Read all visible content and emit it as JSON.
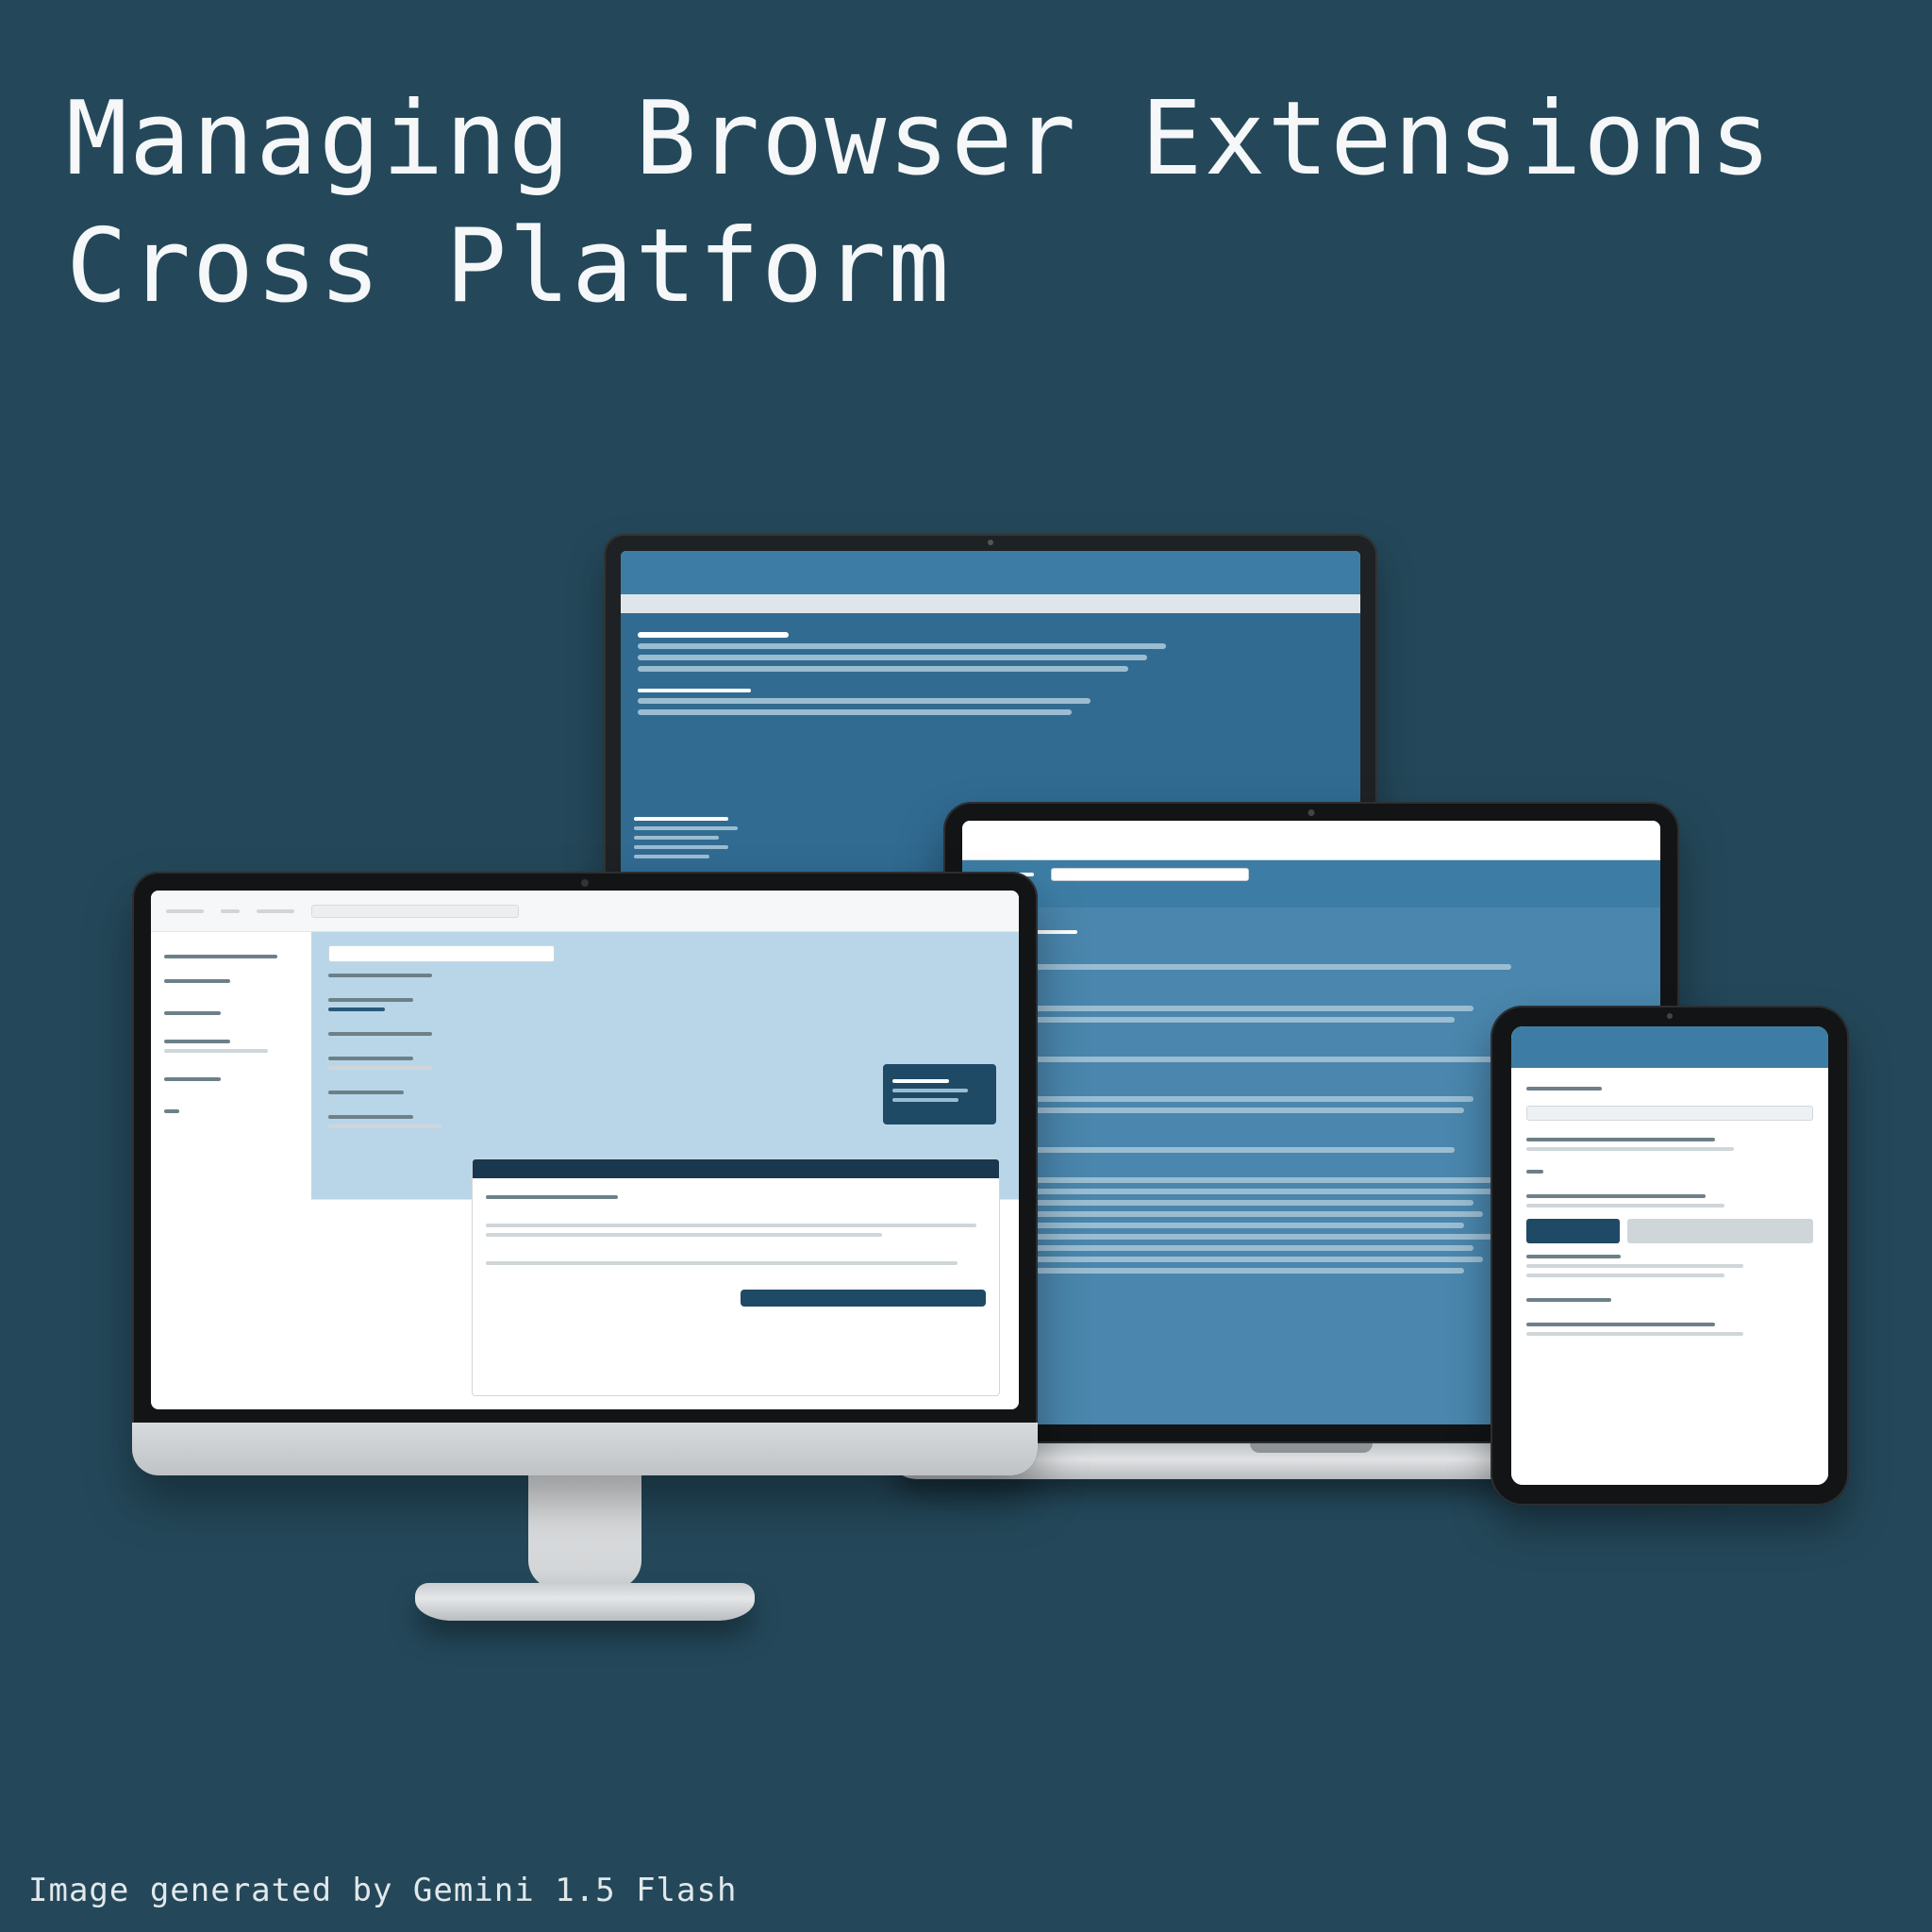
{
  "heading_line1": "Managing Browser Extensions",
  "heading_line2": "Cross Platform",
  "footer_caption": "Image generated by Gemini 1.5 Flash",
  "devices": {
    "imac": {
      "label": "desktop-imac"
    },
    "rear": {
      "label": "desktop-rear"
    },
    "laptop": {
      "label": "laptop"
    },
    "tablet": {
      "label": "tablet"
    }
  },
  "colors": {
    "background": "#24485a",
    "accent_blue": "#3d7da5",
    "dark_blue": "#1e4a66",
    "light_blue": "#b9d6e8"
  }
}
